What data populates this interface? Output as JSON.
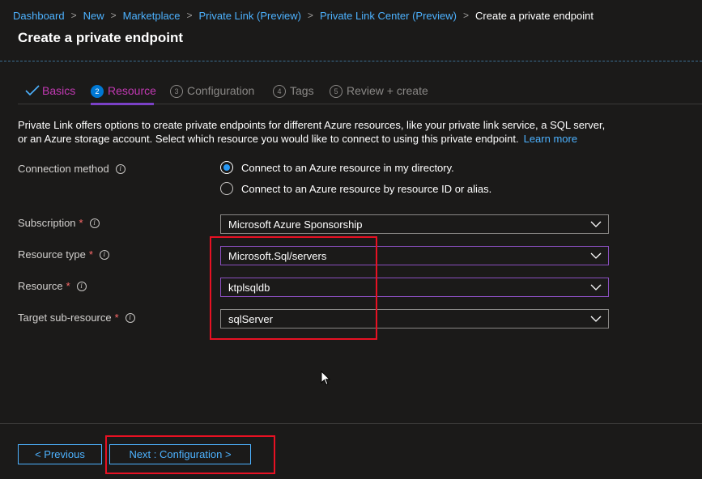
{
  "breadcrumb": {
    "items": [
      "Dashboard",
      "New",
      "Marketplace",
      "Private Link (Preview)",
      "Private Link Center (Preview)"
    ],
    "current": "Create a private endpoint",
    "separator": ">"
  },
  "page": {
    "title": "Create a private endpoint"
  },
  "tabs": [
    {
      "label": "Basics",
      "state": "done",
      "icon": "checkmark-icon"
    },
    {
      "number": "2",
      "label": "Resource",
      "state": "active"
    },
    {
      "number": "3",
      "label": "Configuration",
      "state": "inactive"
    },
    {
      "number": "4",
      "label": "Tags",
      "state": "inactive"
    },
    {
      "number": "5",
      "label": "Review + create",
      "state": "inactive"
    }
  ],
  "description": {
    "text": "Private Link offers options to create private endpoints for different Azure resources, like your private link service, a SQL server, or an Azure storage account. Select which resource you would like to connect to using this private endpoint.",
    "link": "Learn more"
  },
  "connection_method": {
    "label": "Connection method",
    "options": [
      {
        "label": "Connect to an Azure resource in my directory.",
        "selected": true
      },
      {
        "label": "Connect to an Azure resource by resource ID or alias.",
        "selected": false
      }
    ]
  },
  "fields": {
    "subscription": {
      "label": "Subscription",
      "required_mark": "*",
      "value": "Microsoft Azure Sponsorship"
    },
    "resource_type": {
      "label": "Resource type",
      "required_mark": "*",
      "value": "Microsoft.Sql/servers"
    },
    "resource": {
      "label": "Resource",
      "required_mark": "*",
      "value": "ktplsqldb"
    },
    "target_sub_resource": {
      "label": "Target sub-resource",
      "required_mark": "*",
      "value": "sqlServer"
    }
  },
  "info_glyph": "i",
  "footer": {
    "previous_label": "< Previous",
    "next_label": "Next : Configuration >"
  },
  "colors": {
    "background": "#1b1a19",
    "link": "#4db2ff",
    "tab_active": "#c239b3",
    "highlight_box": "#e81123",
    "focus_border": "#8a4fbf"
  }
}
